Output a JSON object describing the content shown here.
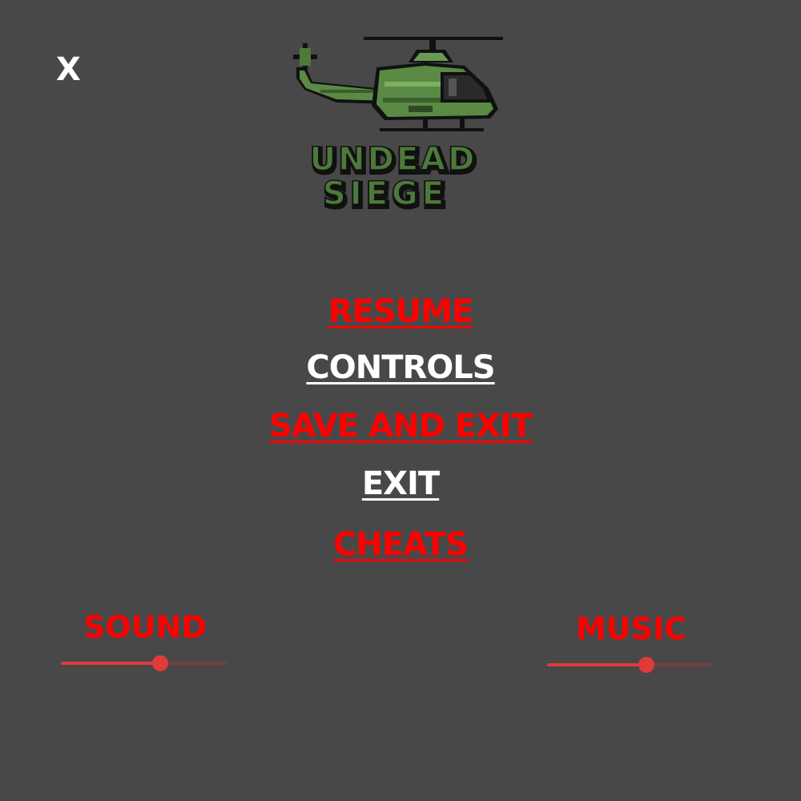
{
  "close": {
    "label": "X"
  },
  "logo": {
    "name": "undead-siege-logo",
    "text_line1": "UNDEAD",
    "text_line2": "SIEGE"
  },
  "menu": {
    "items": [
      {
        "label": "RESUME",
        "color": "#ff0000"
      },
      {
        "label": "CONTROLS",
        "color": "#ffffff"
      },
      {
        "label": "SAVE AND EXIT",
        "color": "#ff0000"
      },
      {
        "label": "EXIT",
        "color": "#ffffff"
      },
      {
        "label": "CHEATS",
        "color": "#ff0000"
      }
    ]
  },
  "sound": {
    "label": "SOUND",
    "value": 0.6
  },
  "music": {
    "label": "MUSIC",
    "value": 0.6
  },
  "colors": {
    "background": "#484848",
    "accent_red": "#ff0000",
    "slider_red": "#e03a3a",
    "logo_green": "#4d7a3a"
  }
}
